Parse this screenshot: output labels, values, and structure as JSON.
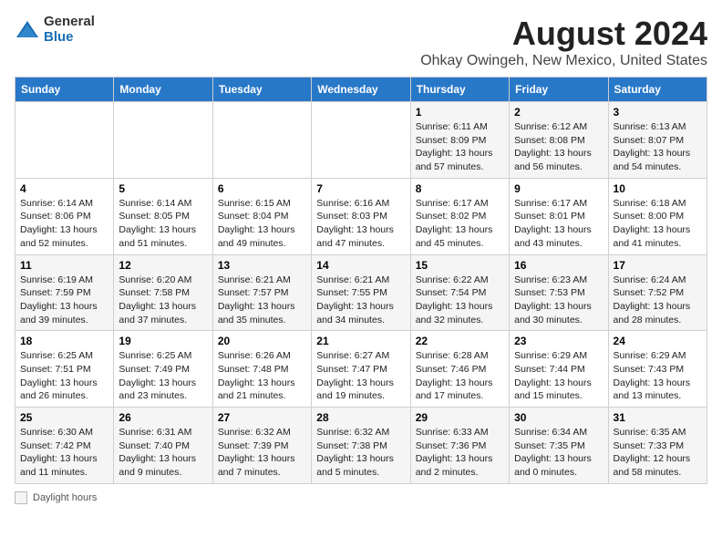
{
  "header": {
    "logo_general": "General",
    "logo_blue": "Blue",
    "title": "August 2024",
    "subtitle": "Ohkay Owingeh, New Mexico, United States"
  },
  "days_of_week": [
    "Sunday",
    "Monday",
    "Tuesday",
    "Wednesday",
    "Thursday",
    "Friday",
    "Saturday"
  ],
  "weeks": [
    [
      {
        "day": "",
        "info": ""
      },
      {
        "day": "",
        "info": ""
      },
      {
        "day": "",
        "info": ""
      },
      {
        "day": "",
        "info": ""
      },
      {
        "day": "1",
        "info": "Sunrise: 6:11 AM\nSunset: 8:09 PM\nDaylight: 13 hours and 57 minutes."
      },
      {
        "day": "2",
        "info": "Sunrise: 6:12 AM\nSunset: 8:08 PM\nDaylight: 13 hours and 56 minutes."
      },
      {
        "day": "3",
        "info": "Sunrise: 6:13 AM\nSunset: 8:07 PM\nDaylight: 13 hours and 54 minutes."
      }
    ],
    [
      {
        "day": "4",
        "info": "Sunrise: 6:14 AM\nSunset: 8:06 PM\nDaylight: 13 hours and 52 minutes."
      },
      {
        "day": "5",
        "info": "Sunrise: 6:14 AM\nSunset: 8:05 PM\nDaylight: 13 hours and 51 minutes."
      },
      {
        "day": "6",
        "info": "Sunrise: 6:15 AM\nSunset: 8:04 PM\nDaylight: 13 hours and 49 minutes."
      },
      {
        "day": "7",
        "info": "Sunrise: 6:16 AM\nSunset: 8:03 PM\nDaylight: 13 hours and 47 minutes."
      },
      {
        "day": "8",
        "info": "Sunrise: 6:17 AM\nSunset: 8:02 PM\nDaylight: 13 hours and 45 minutes."
      },
      {
        "day": "9",
        "info": "Sunrise: 6:17 AM\nSunset: 8:01 PM\nDaylight: 13 hours and 43 minutes."
      },
      {
        "day": "10",
        "info": "Sunrise: 6:18 AM\nSunset: 8:00 PM\nDaylight: 13 hours and 41 minutes."
      }
    ],
    [
      {
        "day": "11",
        "info": "Sunrise: 6:19 AM\nSunset: 7:59 PM\nDaylight: 13 hours and 39 minutes."
      },
      {
        "day": "12",
        "info": "Sunrise: 6:20 AM\nSunset: 7:58 PM\nDaylight: 13 hours and 37 minutes."
      },
      {
        "day": "13",
        "info": "Sunrise: 6:21 AM\nSunset: 7:57 PM\nDaylight: 13 hours and 35 minutes."
      },
      {
        "day": "14",
        "info": "Sunrise: 6:21 AM\nSunset: 7:55 PM\nDaylight: 13 hours and 34 minutes."
      },
      {
        "day": "15",
        "info": "Sunrise: 6:22 AM\nSunset: 7:54 PM\nDaylight: 13 hours and 32 minutes."
      },
      {
        "day": "16",
        "info": "Sunrise: 6:23 AM\nSunset: 7:53 PM\nDaylight: 13 hours and 30 minutes."
      },
      {
        "day": "17",
        "info": "Sunrise: 6:24 AM\nSunset: 7:52 PM\nDaylight: 13 hours and 28 minutes."
      }
    ],
    [
      {
        "day": "18",
        "info": "Sunrise: 6:25 AM\nSunset: 7:51 PM\nDaylight: 13 hours and 26 minutes."
      },
      {
        "day": "19",
        "info": "Sunrise: 6:25 AM\nSunset: 7:49 PM\nDaylight: 13 hours and 23 minutes."
      },
      {
        "day": "20",
        "info": "Sunrise: 6:26 AM\nSunset: 7:48 PM\nDaylight: 13 hours and 21 minutes."
      },
      {
        "day": "21",
        "info": "Sunrise: 6:27 AM\nSunset: 7:47 PM\nDaylight: 13 hours and 19 minutes."
      },
      {
        "day": "22",
        "info": "Sunrise: 6:28 AM\nSunset: 7:46 PM\nDaylight: 13 hours and 17 minutes."
      },
      {
        "day": "23",
        "info": "Sunrise: 6:29 AM\nSunset: 7:44 PM\nDaylight: 13 hours and 15 minutes."
      },
      {
        "day": "24",
        "info": "Sunrise: 6:29 AM\nSunset: 7:43 PM\nDaylight: 13 hours and 13 minutes."
      }
    ],
    [
      {
        "day": "25",
        "info": "Sunrise: 6:30 AM\nSunset: 7:42 PM\nDaylight: 13 hours and 11 minutes."
      },
      {
        "day": "26",
        "info": "Sunrise: 6:31 AM\nSunset: 7:40 PM\nDaylight: 13 hours and 9 minutes."
      },
      {
        "day": "27",
        "info": "Sunrise: 6:32 AM\nSunset: 7:39 PM\nDaylight: 13 hours and 7 minutes."
      },
      {
        "day": "28",
        "info": "Sunrise: 6:32 AM\nSunset: 7:38 PM\nDaylight: 13 hours and 5 minutes."
      },
      {
        "day": "29",
        "info": "Sunrise: 6:33 AM\nSunset: 7:36 PM\nDaylight: 13 hours and 2 minutes."
      },
      {
        "day": "30",
        "info": "Sunrise: 6:34 AM\nSunset: 7:35 PM\nDaylight: 13 hours and 0 minutes."
      },
      {
        "day": "31",
        "info": "Sunrise: 6:35 AM\nSunset: 7:33 PM\nDaylight: 12 hours and 58 minutes."
      }
    ]
  ],
  "footer": {
    "daylight_label": "Daylight hours"
  }
}
